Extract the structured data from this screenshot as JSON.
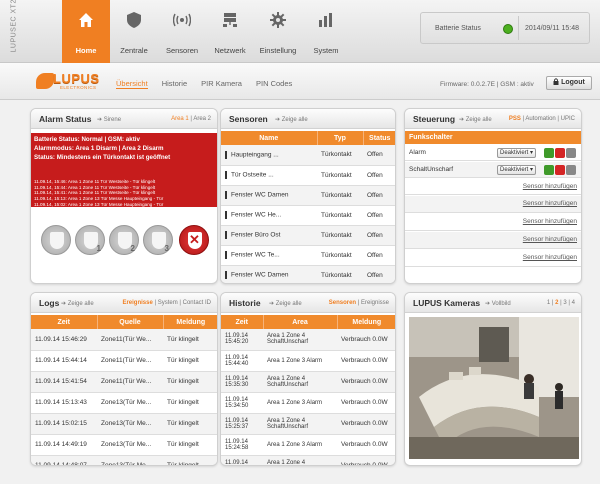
{
  "brand": "LUPUSEC XT2",
  "nav": [
    {
      "label": "Home",
      "icon": "home-icon",
      "active": true
    },
    {
      "label": "Zentrale",
      "icon": "shield-icon"
    },
    {
      "label": "Sensoren",
      "icon": "signal-icon"
    },
    {
      "label": "Netzwerk",
      "icon": "network-icon"
    },
    {
      "label": "Einstellung",
      "icon": "gear-icon"
    },
    {
      "label": "System",
      "icon": "system-icon"
    }
  ],
  "status": {
    "label": "Batterie Status",
    "datetime": "2014/09/11 15:48",
    "indicator_color": "#4caf1f"
  },
  "logo": {
    "word": "LUPUS",
    "sub": "ELECTRONICS"
  },
  "subnav": [
    "Übersicht",
    "Historie",
    "PIR Kamera",
    "PIN Codes"
  ],
  "firmware": "Firmware: 0.0.2.7E | GSM : aktiv",
  "logout": "Logout",
  "alarm": {
    "title": "Alarm Status",
    "sub": "Sirene",
    "area1": "Area 1",
    "area2": "Area 2",
    "lines": [
      "Batterie Status: Normal | GSM: aktiv",
      "Alarmmodus: Area 1 Disarm | Area 2 Disarm",
      "Status: Mindestens ein Türkontakt ist geöffnet"
    ],
    "log": [
      "11.09.14, 15:46: Area 1 Zone 11 Tür Westseite - Tür klingelt",
      "11.09.14, 15:44: Area 1 Zone 11 Tür Westseite - Tür klingelt",
      "11.09.14, 15:41: Area 1 Zone 11 Tür Westseite - Tür klingelt",
      "11.09.14, 15:13: Area 1 Zone 13 Tür Messe Haupteingang - Tür",
      "11.09.14, 15:02: Area 1 Zone 13 Tür Messe Haupteingang - Tür"
    ],
    "shields": [
      "",
      "1",
      "2",
      "3",
      ""
    ]
  },
  "sensors": {
    "title": "Sensoren",
    "sub": "Zeige alle",
    "headers": [
      "Name",
      "Typ",
      "Status"
    ],
    "rows": [
      [
        "Haupteingang ...",
        "Türkontakt",
        "Offen"
      ],
      [
        "Tür Ostseite ...",
        "Türkontakt",
        "Offen"
      ],
      [
        "Fenster WC Damen",
        "Türkontakt",
        "Offen"
      ],
      [
        "Fenster WC He...",
        "Türkontakt",
        "Offen"
      ],
      [
        "Fenster Büro Ost",
        "Türkontakt",
        "Offen"
      ],
      [
        "Fenster WC Te...",
        "Türkontakt",
        "Offen"
      ],
      [
        "Fenster WC Damen",
        "Türkontakt",
        "Offen"
      ]
    ]
  },
  "control": {
    "title": "Steuerung",
    "sub": "Zeige alle",
    "tabs": [
      "PSS",
      "Automation",
      "UPIC"
    ],
    "header": "Funkschalter",
    "rows": [
      {
        "name": "Alarm",
        "select": "Deaktiviert"
      },
      {
        "name": "SchaltUnscharf",
        "select": "Deaktiviert"
      }
    ],
    "add_links": [
      "Sensor hinzufügen",
      "Sensor hinzufügen",
      "Sensor hinzufügen",
      "Sensor hinzufügen",
      "Sensor hinzufügen"
    ]
  },
  "logs": {
    "title": "Logs",
    "sub": "Zeige alle",
    "tabs": [
      "Ereignisse",
      "System",
      "Contact ID"
    ],
    "headers": [
      "Zeit",
      "Quelle",
      "Meldung"
    ],
    "rows": [
      [
        "11.09.14 15:46:29",
        "Zone11(Tür We...",
        "Tür klingelt"
      ],
      [
        "11.09.14 15:44:14",
        "Zone11(Tür We...",
        "Tür klingelt"
      ],
      [
        "11.09.14 15:41:54",
        "Zone11(Tür We...",
        "Tür klingelt"
      ],
      [
        "11.09.14 15:13:43",
        "Zone13(Tür Me...",
        "Tür klingelt"
      ],
      [
        "11.09.14 15:02:15",
        "Zone13(Tür Me...",
        "Tür klingelt"
      ],
      [
        "11.09.14 14:49:19",
        "Zone13(Tür Me...",
        "Tür klingelt"
      ],
      [
        "11.09.14 14:48:07",
        "Zone13(Tür Me...",
        "Tür klingelt"
      ]
    ]
  },
  "history": {
    "title": "Historie",
    "sub": "Zeige alle",
    "tabs": [
      "Sensoren",
      "Ereignisse"
    ],
    "headers": [
      "Zeit",
      "Area",
      "Meldung"
    ],
    "rows": [
      [
        "11.09.14 15:45:20",
        "Area 1 Zone 4 SchaftUnscharf",
        "Verbrauch 0.0W"
      ],
      [
        "11.09.14 15:44:40",
        "Area 1 Zone 3 Alarm",
        "Verbrauch 0.0W"
      ],
      [
        "11.09.14 15:35:30",
        "Area 1 Zone 4 SchaftUnscharf",
        "Verbrauch 0.0W"
      ],
      [
        "11.09.14 15:34:50",
        "Area 1 Zone 3 Alarm",
        "Verbrauch 0.0W"
      ],
      [
        "11.09.14 15:25:37",
        "Area 1 Zone 4 SchaftUnscharf",
        "Verbrauch 0.0W"
      ],
      [
        "11.09.14 15:24:58",
        "Area 1 Zone 3 Alarm",
        "Verbrauch 0.0W"
      ],
      [
        "11.09.14 15:15:44",
        "Area 1 Zone 4 SchaftUnscharf",
        "Verbrauch 0.0W"
      ]
    ]
  },
  "cameras": {
    "title": "LUPUS Kameras",
    "sub": "Vollbild",
    "pages": [
      "1",
      "2",
      "3",
      "4"
    ],
    "active_page": "2"
  }
}
